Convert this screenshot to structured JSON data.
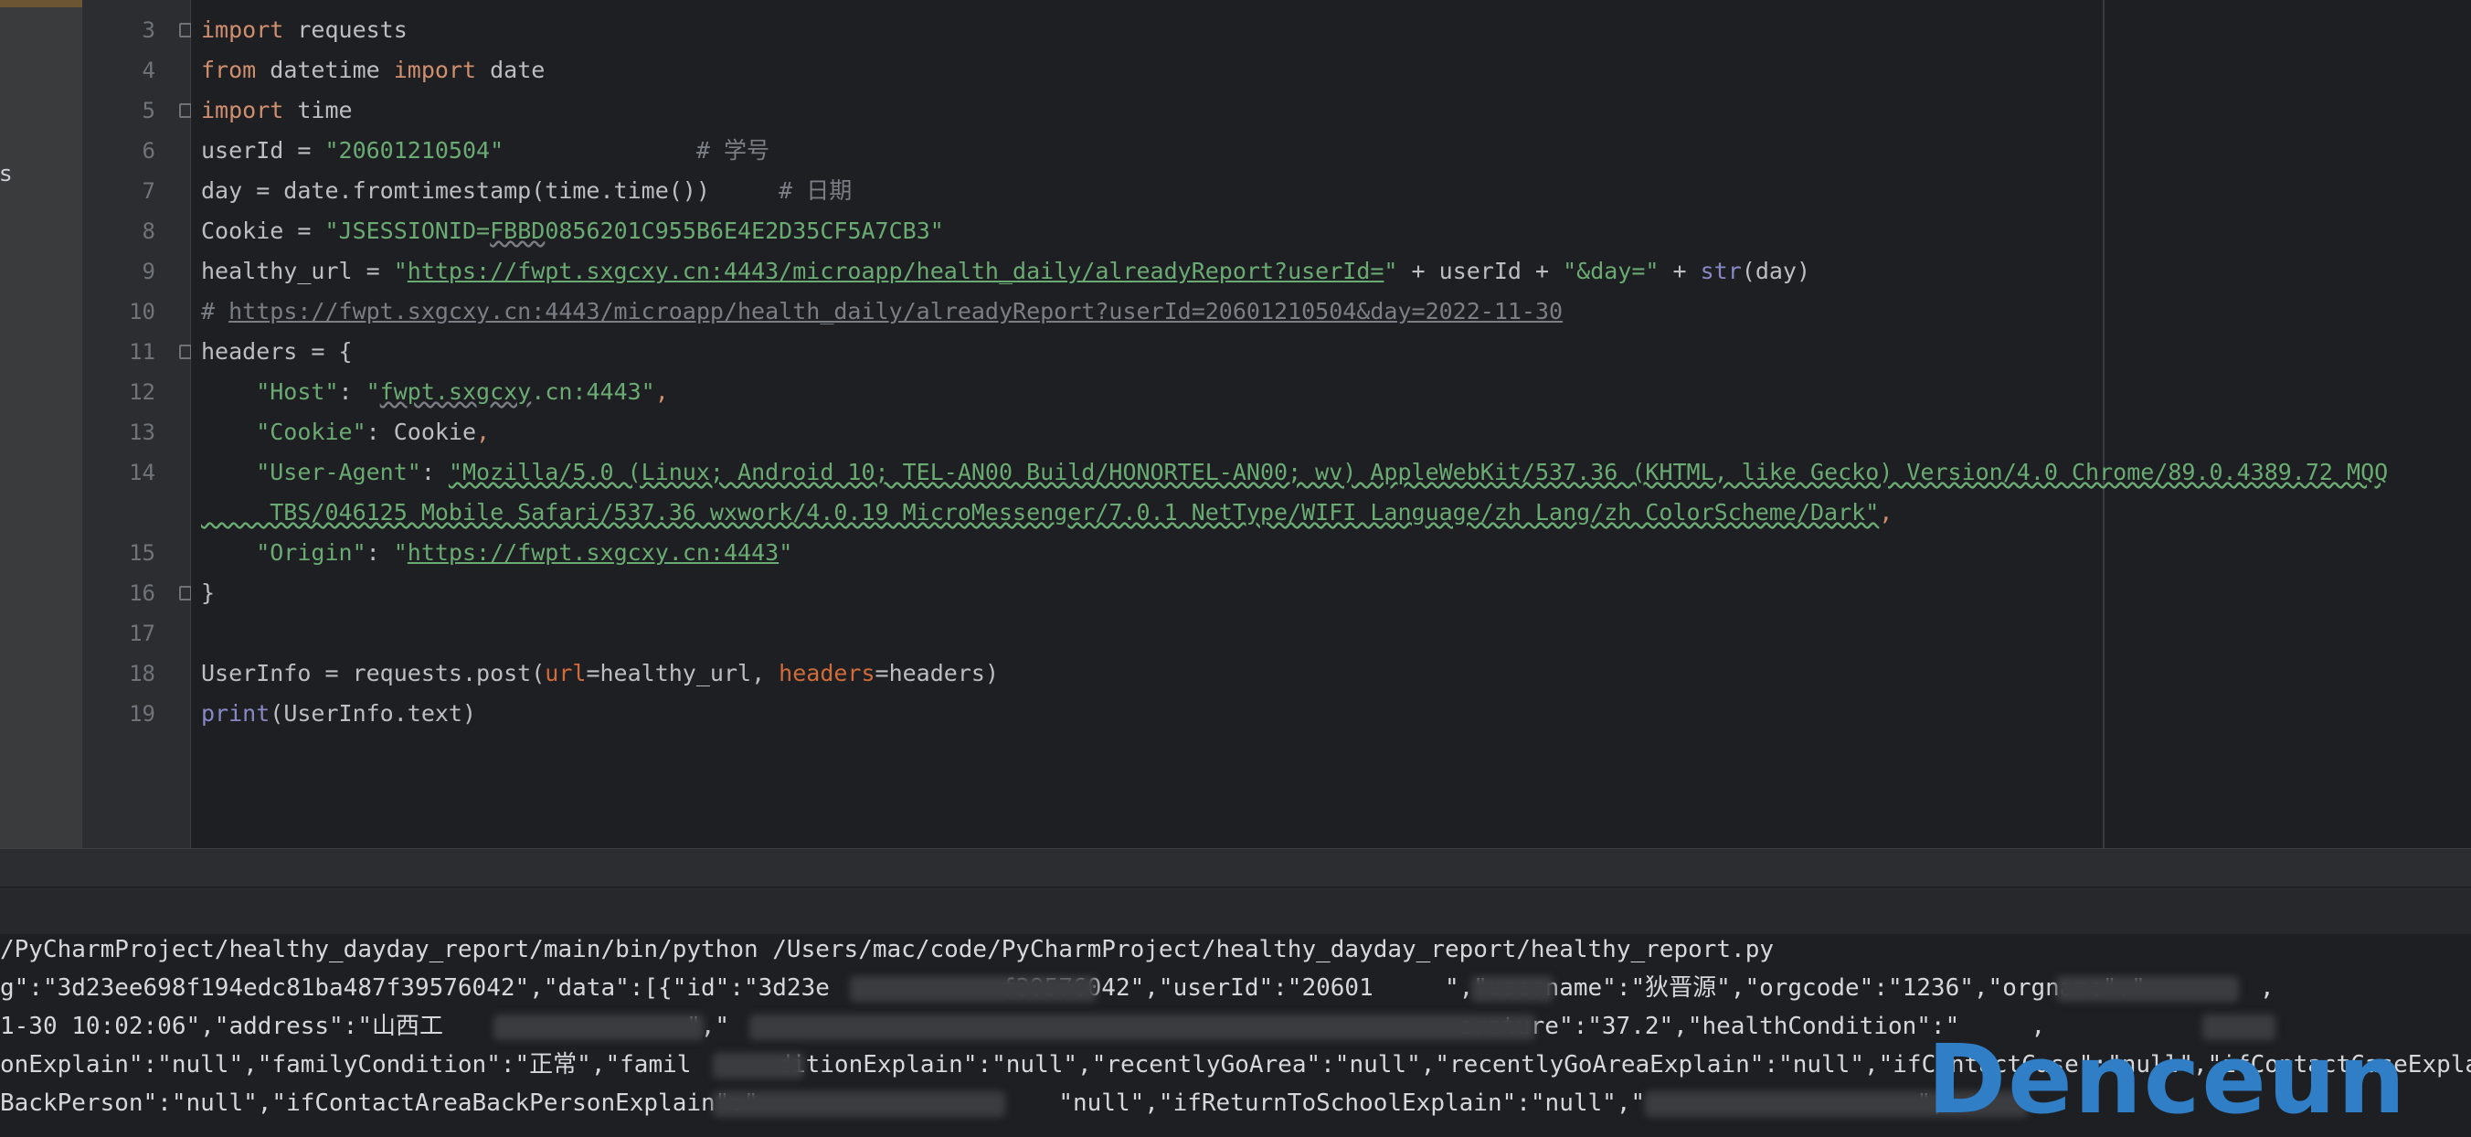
{
  "project_panel": {
    "cut_label": "s"
  },
  "editor": {
    "line_numbers": [
      "3",
      "4",
      "5",
      "6",
      "7",
      "8",
      "9",
      "10",
      "11",
      "12",
      "13",
      "14",
      "15",
      "16",
      "17",
      "18",
      "19"
    ],
    "code": {
      "l3_kw": "import",
      "l3_rest": " requests",
      "l4_kw1": "from",
      "l4_mid": " datetime ",
      "l4_kw2": "import",
      "l4_rest": " date",
      "l5_kw": "import",
      "l5_rest": " time",
      "l6_a": "userId = ",
      "l6_str": "\"20601210504\"",
      "l6_cmt": "              # 学号",
      "l7_a": "day = date.fromtimestamp(time.time())",
      "l7_cmt": "     # 日期",
      "l8_a": "Cookie = ",
      "l8_str1": "\"JSESSIONID=",
      "l8_wavy": "FBBD",
      "l8_str2": "0856201C955B6E4E2D35CF5A7CB3\"",
      "l9_a": "healthy_url = ",
      "l9_q": "\"",
      "l9_url": "https://fwpt.sxgcxy.cn:4443/microapp/health_daily/alreadyReport?userId=",
      "l9_q2": "\"",
      "l9_b": " + userId + ",
      "l9_str": "\"&day=\"",
      "l9_c": " + ",
      "l9_bi": "str",
      "l9_d": "(day)",
      "l10_hash": "# ",
      "l10_url": "https://fwpt.sxgcxy.cn:4443/microapp/health_daily/alreadyReport?userId=20601210504&day=2022-11-30",
      "l11": "headers = {",
      "l12_key": "    \"Host\"",
      "l12_colon": ": ",
      "l12_q": "\"",
      "l12_wavy": "fwpt.sxgcxy",
      "l12_rest": ".cn:4443\"",
      "l12_comma": ",",
      "l13_key": "    \"Cookie\"",
      "l13_val": ": Cookie",
      "l13_comma": ",",
      "l14_key": "    \"User-Agent\"",
      "l14_colon": ": ",
      "l14_val": "\"Mozilla/5.0 (Linux; Android 10; TEL-AN00 Build/HONORTEL-AN00; wv) AppleWebKit/537.36 (KHTML, like Gecko) Version/4.0 Chrome/89.0.4389.72 MQQ",
      "l14b_val": "     TBS/046125 Mobile Safari/537.36 wxwork/4.0.19 MicroMessenger/7.0.1 NetType/WIFI Language/zh Lang/zh ColorScheme/Dark\"",
      "l14b_comma": ",",
      "l15_key": "    \"Origin\"",
      "l15_colon": ": ",
      "l15_q": "\"",
      "l15_url": "https://fwpt.sxgcxy.cn:4443",
      "l15_q2": "\"",
      "l16": "}",
      "l18_a": "UserInfo = requests.post(",
      "l18_p1": "url",
      "l18_b": "=healthy_url, ",
      "l18_p2": "headers",
      "l18_c": "=headers)",
      "l19_bi": "print",
      "l19_rest": "(UserInfo.text)"
    }
  },
  "console": {
    "lines": [
      "/PyCharmProject/healthy_dayday_report/main/bin/python /Users/mac/code/PyCharmProject/healthy_dayday_report/healthy_report.py",
      "g\":\"3d23ee698f194edc81ba487f39576042\",\"data\":[{\"id\":\"3d23e            f39576042\",\"userId\":\"20601     \",\"username\":\"狄晋源\",\"orgcode\":\"1236\",\"orgname\":\"        ,",
      "1-30 10:02:06\",\"address\":\"山西工                 \",\"                                                   erature\":\"37.2\",\"healthCondition\":\"     ,",
      "onExplain\":\"null\",\"familyCondition\":\"正常\",\"famil      ditionExplain\":\"null\",\"recentlyGoArea\":\"null\",\"recentlyGoAreaExplain\":\"null\",\"ifContactCase\":\"null\",\"ifContactCaseExplain",
      "BackPerson\":\"null\",\"ifContactAreaBackPersonExplain\":\"                     \"null\",\"ifReturnToSchoolExplain\":\"null\",\"                   \","
    ]
  },
  "watermark": "Denceun"
}
